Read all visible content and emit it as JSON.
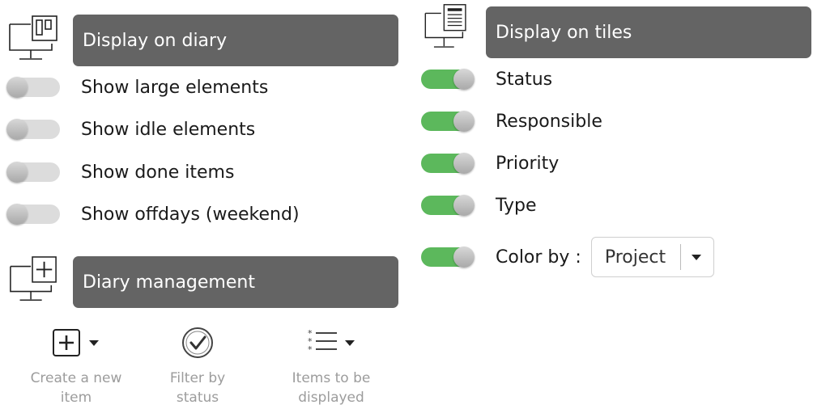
{
  "diary_display": {
    "title": "Display on diary",
    "options": [
      {
        "label": "Show large elements",
        "enabled": false
      },
      {
        "label": "Show idle elements",
        "enabled": false
      },
      {
        "label": "Show done items",
        "enabled": false
      },
      {
        "label": "Show offdays (weekend)",
        "enabled": false
      }
    ]
  },
  "diary_management": {
    "title": "Diary management",
    "tools": [
      {
        "label": "Create a new item",
        "icon": "plus-box-icon"
      },
      {
        "label": "Filter by status",
        "icon": "check-circle-icon"
      },
      {
        "label": "Items to be displayed",
        "icon": "list-icon"
      }
    ]
  },
  "tiles_display": {
    "title": "Display on tiles",
    "options": [
      {
        "label": "Status",
        "enabled": true
      },
      {
        "label": "Responsible",
        "enabled": true
      },
      {
        "label": "Priority",
        "enabled": true
      },
      {
        "label": "Type",
        "enabled": true
      }
    ],
    "color_by": {
      "label": "Color by :",
      "enabled": true,
      "selected": "Project"
    }
  },
  "colors": {
    "header_bg": "#646464",
    "toggle_on": "#5cb85c",
    "toggle_off": "#dcdcdc",
    "tool_text": "#9c9c9c"
  }
}
